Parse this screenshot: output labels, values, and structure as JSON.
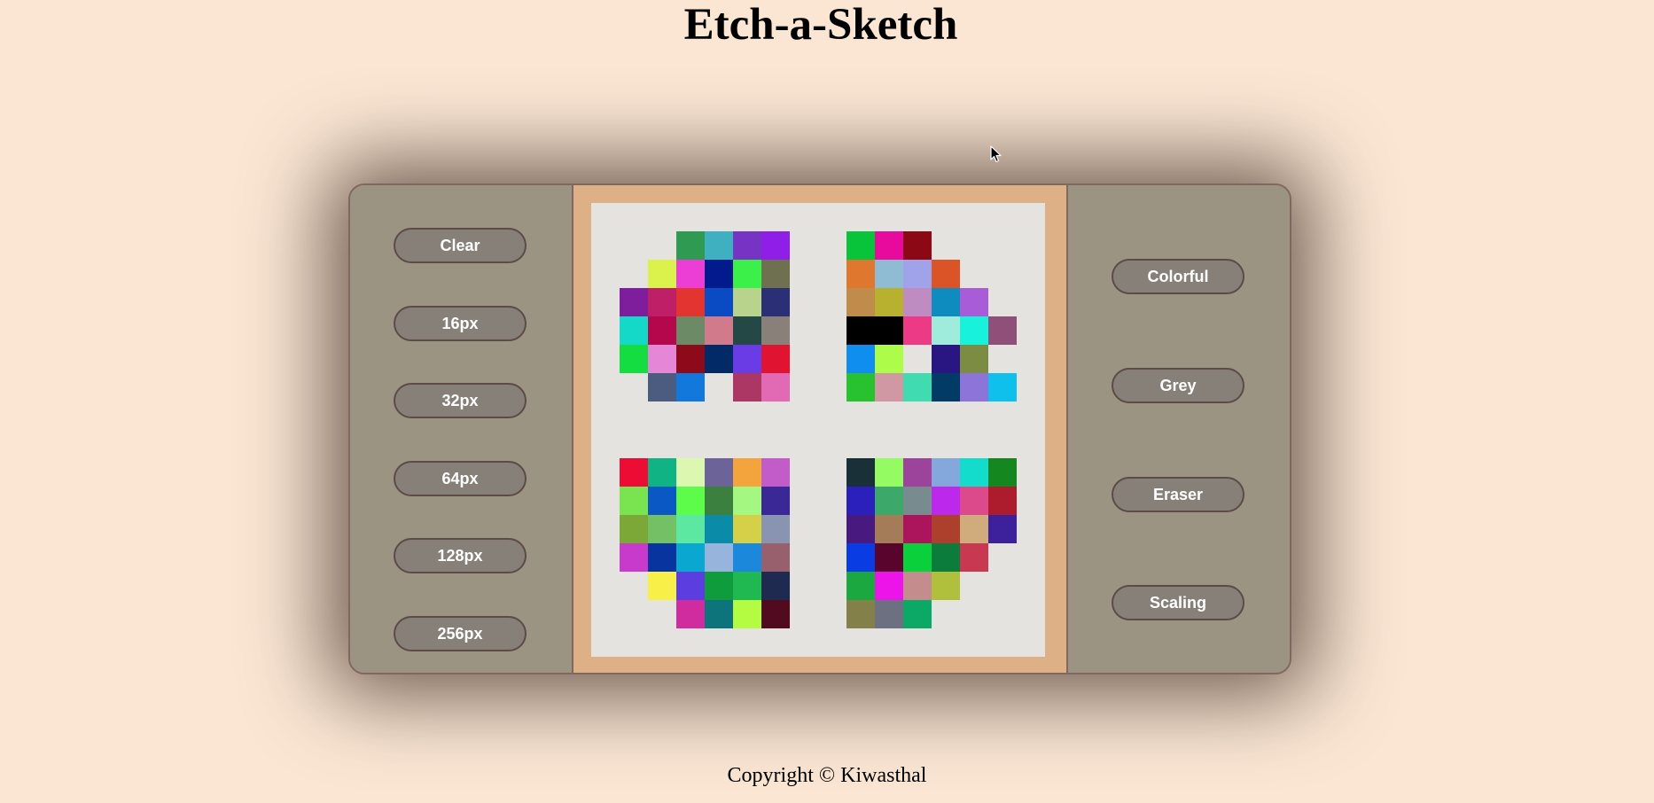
{
  "title": "Etch-a-Sketch",
  "left_controls": {
    "clear_label": "Clear",
    "px16_label": "16px",
    "px32_label": "32px",
    "px64_label": "64px",
    "px128_label": "128px",
    "px256_label": "256px"
  },
  "right_controls": {
    "colorful_label": "Colorful",
    "grey_label": "Grey",
    "eraser_label": "Eraser",
    "scaling_label": "Scaling"
  },
  "footer": {
    "copyright": "Copyright © Kiwasthal"
  },
  "canvas": {
    "grid_size": 16,
    "background": "#e4e3df",
    "painted_cells": [
      [
        1,
        3,
        "#2e9a52"
      ],
      [
        1,
        4,
        "#3fb0c0"
      ],
      [
        1,
        5,
        "#7733c4"
      ],
      [
        1,
        6,
        "#8f1fe8"
      ],
      [
        2,
        2,
        "#dcf24c"
      ],
      [
        2,
        3,
        "#ec3dd4"
      ],
      [
        2,
        4,
        "#021a8c"
      ],
      [
        2,
        5,
        "#3bf048"
      ],
      [
        2,
        6,
        "#6f7050"
      ],
      [
        3,
        1,
        "#7e1e9c"
      ],
      [
        3,
        2,
        "#bf1f66"
      ],
      [
        3,
        3,
        "#e4342f"
      ],
      [
        3,
        4,
        "#0a4bc4"
      ],
      [
        3,
        5,
        "#b8d48c"
      ],
      [
        3,
        6,
        "#2b3076"
      ],
      [
        4,
        1,
        "#14d8c8"
      ],
      [
        4,
        2,
        "#b4074c"
      ],
      [
        4,
        3,
        "#6d8a66"
      ],
      [
        4,
        4,
        "#d07a8c"
      ],
      [
        4,
        5,
        "#244846"
      ],
      [
        4,
        6,
        "#888079"
      ],
      [
        5,
        1,
        "#14dd41"
      ],
      [
        5,
        2,
        "#e587d6"
      ],
      [
        5,
        3,
        "#8c0a1a"
      ],
      [
        5,
        4,
        "#022a66"
      ],
      [
        5,
        5,
        "#6a3ce6"
      ],
      [
        5,
        6,
        "#e01431"
      ],
      [
        6,
        2,
        "#4b5c80"
      ],
      [
        6,
        3,
        "#1278dc"
      ],
      [
        6,
        5,
        "#ac3664"
      ],
      [
        6,
        6,
        "#e26ab4"
      ],
      [
        1,
        9,
        "#08c43a"
      ],
      [
        1,
        10,
        "#e80a9c"
      ],
      [
        1,
        11,
        "#8c0814"
      ],
      [
        2,
        9,
        "#df782e"
      ],
      [
        2,
        10,
        "#8fbcd2"
      ],
      [
        2,
        11,
        "#a0a2ea"
      ],
      [
        2,
        12,
        "#da5428"
      ],
      [
        3,
        9,
        "#bf8c4c"
      ],
      [
        3,
        10,
        "#b8b02f"
      ],
      [
        3,
        11,
        "#be8cc0"
      ],
      [
        3,
        12,
        "#0e8cc0"
      ],
      [
        3,
        13,
        "#a85cd8"
      ],
      [
        4,
        9,
        "#000000"
      ],
      [
        4,
        10,
        "#000000"
      ],
      [
        4,
        11,
        "#ec3a86"
      ],
      [
        4,
        12,
        "#a0ecdc"
      ],
      [
        4,
        13,
        "#18f2da"
      ],
      [
        4,
        14,
        "#8e5078"
      ],
      [
        5,
        9,
        "#0f8ef0"
      ],
      [
        5,
        10,
        "#aefc4a"
      ],
      [
        5,
        12,
        "#2a1682"
      ],
      [
        5,
        13,
        "#7c8c42"
      ],
      [
        6,
        9,
        "#28c230"
      ],
      [
        6,
        10,
        "#d098a2"
      ],
      [
        6,
        11,
        "#40dcb0"
      ],
      [
        6,
        12,
        "#023c66"
      ],
      [
        6,
        13,
        "#8c74d8"
      ],
      [
        6,
        14,
        "#10c0ec"
      ],
      [
        9,
        1,
        "#ec0c34"
      ],
      [
        9,
        2,
        "#10b484"
      ],
      [
        9,
        3,
        "#dcf8b0"
      ],
      [
        9,
        4,
        "#6c6498"
      ],
      [
        9,
        5,
        "#f4a43c"
      ],
      [
        9,
        6,
        "#c25cc8"
      ],
      [
        10,
        1,
        "#7ae450"
      ],
      [
        10,
        2,
        "#0a58c4"
      ],
      [
        10,
        3,
        "#5efc4a"
      ],
      [
        10,
        4,
        "#3c8040"
      ],
      [
        10,
        5,
        "#a4f882"
      ],
      [
        10,
        6,
        "#3a2896"
      ],
      [
        11,
        1,
        "#7ca838"
      ],
      [
        11,
        2,
        "#74c064"
      ],
      [
        11,
        3,
        "#5ce8a0"
      ],
      [
        11,
        4,
        "#0a8ca8"
      ],
      [
        11,
        5,
        "#d4d048"
      ],
      [
        11,
        6,
        "#8894b0"
      ],
      [
        12,
        1,
        "#c83acc"
      ],
      [
        12,
        2,
        "#0834a0"
      ],
      [
        12,
        3,
        "#0aa8d0"
      ],
      [
        12,
        4,
        "#96b4dc"
      ],
      [
        12,
        5,
        "#1c88dc"
      ],
      [
        12,
        6,
        "#98606c"
      ],
      [
        13,
        2,
        "#f8f048"
      ],
      [
        13,
        3,
        "#5c3ee0"
      ],
      [
        13,
        4,
        "#0e9c3c"
      ],
      [
        13,
        5,
        "#20b850"
      ],
      [
        13,
        6,
        "#1e2a50"
      ],
      [
        14,
        3,
        "#d02ca0"
      ],
      [
        14,
        4,
        "#0e747c"
      ],
      [
        14,
        5,
        "#b4fc42"
      ],
      [
        14,
        6,
        "#520a1e"
      ],
      [
        9,
        9,
        "#1a3038"
      ],
      [
        9,
        10,
        "#94fc62"
      ],
      [
        9,
        11,
        "#9c449c"
      ],
      [
        9,
        12,
        "#84a8dc"
      ],
      [
        9,
        13,
        "#14dccc"
      ],
      [
        9,
        14,
        "#14881e"
      ],
      [
        10,
        9,
        "#2c20bc"
      ],
      [
        10,
        10,
        "#3ca86a"
      ],
      [
        10,
        11,
        "#788c90"
      ],
      [
        10,
        12,
        "#bc28ec"
      ],
      [
        10,
        13,
        "#dc4a8c"
      ],
      [
        10,
        14,
        "#ac1c2c"
      ],
      [
        11,
        9,
        "#481a80"
      ],
      [
        11,
        10,
        "#a47c58"
      ],
      [
        11,
        11,
        "#ac145c"
      ],
      [
        11,
        12,
        "#ac402c"
      ],
      [
        11,
        13,
        "#d0ac7c"
      ],
      [
        11,
        14,
        "#3c209c"
      ],
      [
        12,
        9,
        "#0a3ce4"
      ],
      [
        12,
        10,
        "#58042c"
      ],
      [
        12,
        11,
        "#0ad03c"
      ],
      [
        12,
        12,
        "#0c7c3c"
      ],
      [
        12,
        13,
        "#c83850"
      ],
      [
        13,
        9,
        "#1ca840"
      ],
      [
        13,
        10,
        "#ec14e8"
      ],
      [
        13,
        11,
        "#c48c8c"
      ],
      [
        13,
        12,
        "#b0c03c"
      ],
      [
        14,
        9,
        "#84804a"
      ],
      [
        14,
        10,
        "#6c7080"
      ],
      [
        14,
        11,
        "#0ca866"
      ]
    ]
  }
}
